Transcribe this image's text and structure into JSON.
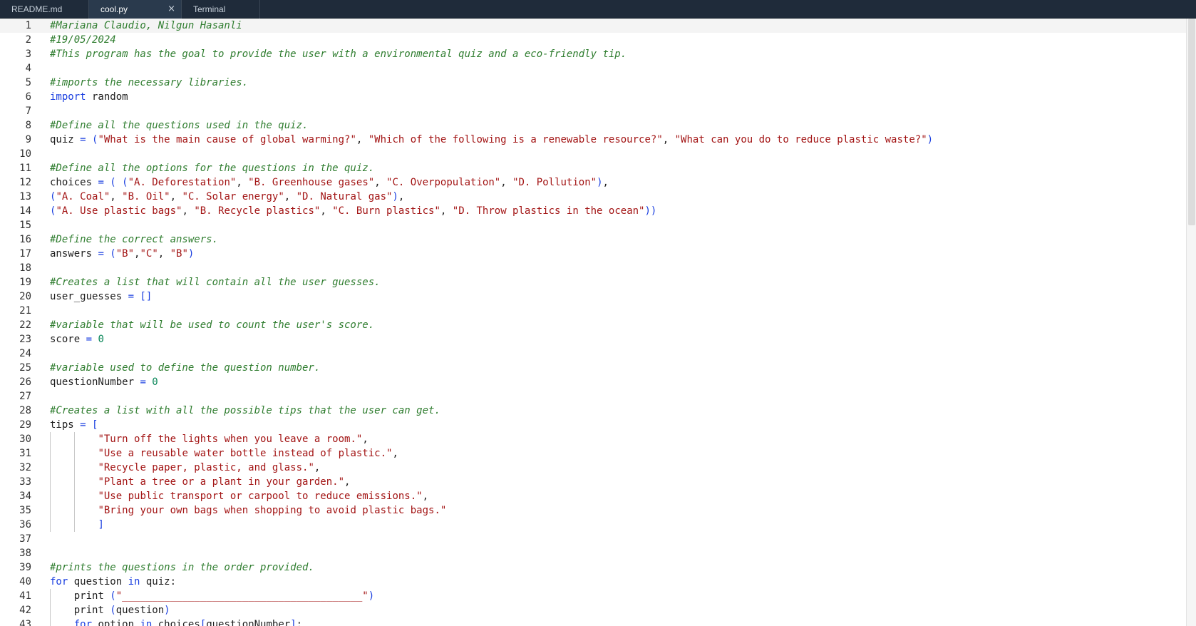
{
  "tabs": [
    {
      "label": "README.md",
      "active": false
    },
    {
      "label": "cool.py",
      "active": true,
      "close": "×"
    },
    {
      "label": "Terminal",
      "active": false
    }
  ],
  "editor": {
    "current_line": 1,
    "lines": [
      {
        "n": "1",
        "tokens": [
          {
            "c": "com",
            "t": "#Mariana Claudio, Nilgun Hasanli"
          }
        ]
      },
      {
        "n": "2",
        "tokens": [
          {
            "c": "com",
            "t": "#19/05/2024"
          }
        ]
      },
      {
        "n": "3",
        "tokens": [
          {
            "c": "com",
            "t": "#This program has the goal to provide the user with a environmental quiz and a eco-friendly tip."
          }
        ]
      },
      {
        "n": "4",
        "tokens": []
      },
      {
        "n": "5",
        "tokens": [
          {
            "c": "com",
            "t": "#imports the necessary libraries."
          }
        ]
      },
      {
        "n": "6",
        "tokens": [
          {
            "c": "kw",
            "t": "import"
          },
          {
            "c": "id",
            "t": " random"
          }
        ]
      },
      {
        "n": "7",
        "tokens": []
      },
      {
        "n": "8",
        "tokens": [
          {
            "c": "com",
            "t": "#Define all the questions used in the quiz."
          }
        ]
      },
      {
        "n": "9",
        "tokens": [
          {
            "c": "id",
            "t": "quiz "
          },
          {
            "c": "op",
            "t": "= ("
          },
          {
            "c": "str",
            "t": "\"What is the main cause of global warming?\""
          },
          {
            "c": "id",
            "t": ", "
          },
          {
            "c": "str",
            "t": "\"Which of the following is a renewable resource?\""
          },
          {
            "c": "id",
            "t": ", "
          },
          {
            "c": "str",
            "t": "\"What can you do to reduce plastic waste?\""
          },
          {
            "c": "op",
            "t": ")"
          }
        ]
      },
      {
        "n": "10",
        "tokens": []
      },
      {
        "n": "11",
        "tokens": [
          {
            "c": "com",
            "t": "#Define all the options for the questions in the quiz."
          }
        ]
      },
      {
        "n": "12",
        "tokens": [
          {
            "c": "id",
            "t": "choices "
          },
          {
            "c": "op",
            "t": "= ( ("
          },
          {
            "c": "str",
            "t": "\"A. Deforestation\""
          },
          {
            "c": "id",
            "t": ", "
          },
          {
            "c": "str",
            "t": "\"B. Greenhouse gases\""
          },
          {
            "c": "id",
            "t": ", "
          },
          {
            "c": "str",
            "t": "\"C. Overpopulation\""
          },
          {
            "c": "id",
            "t": ", "
          },
          {
            "c": "str",
            "t": "\"D. Pollution\""
          },
          {
            "c": "op",
            "t": ")"
          },
          {
            "c": "id",
            "t": ","
          }
        ]
      },
      {
        "n": "13",
        "tokens": [
          {
            "c": "op",
            "t": "("
          },
          {
            "c": "str",
            "t": "\"A. Coal\""
          },
          {
            "c": "id",
            "t": ", "
          },
          {
            "c": "str",
            "t": "\"B. Oil\""
          },
          {
            "c": "id",
            "t": ", "
          },
          {
            "c": "str",
            "t": "\"C. Solar energy\""
          },
          {
            "c": "id",
            "t": ", "
          },
          {
            "c": "str",
            "t": "\"D. Natural gas\""
          },
          {
            "c": "op",
            "t": ")"
          },
          {
            "c": "id",
            "t": ","
          }
        ]
      },
      {
        "n": "14",
        "tokens": [
          {
            "c": "op",
            "t": "("
          },
          {
            "c": "str",
            "t": "\"A. Use plastic bags\""
          },
          {
            "c": "id",
            "t": ", "
          },
          {
            "c": "str",
            "t": "\"B. Recycle plastics\""
          },
          {
            "c": "id",
            "t": ", "
          },
          {
            "c": "str",
            "t": "\"C. Burn plastics\""
          },
          {
            "c": "id",
            "t": ", "
          },
          {
            "c": "str",
            "t": "\"D. Throw plastics in the ocean\""
          },
          {
            "c": "op",
            "t": "))"
          }
        ]
      },
      {
        "n": "15",
        "tokens": []
      },
      {
        "n": "16",
        "tokens": [
          {
            "c": "com",
            "t": "#Define the correct answers."
          }
        ]
      },
      {
        "n": "17",
        "tokens": [
          {
            "c": "id",
            "t": "answers "
          },
          {
            "c": "op",
            "t": "= ("
          },
          {
            "c": "str",
            "t": "\"B\""
          },
          {
            "c": "id",
            "t": ","
          },
          {
            "c": "str",
            "t": "\"C\""
          },
          {
            "c": "id",
            "t": ", "
          },
          {
            "c": "str",
            "t": "\"B\""
          },
          {
            "c": "op",
            "t": ")"
          }
        ]
      },
      {
        "n": "18",
        "tokens": []
      },
      {
        "n": "19",
        "tokens": [
          {
            "c": "com",
            "t": "#Creates a list that will contain all the user guesses."
          }
        ]
      },
      {
        "n": "20",
        "tokens": [
          {
            "c": "id",
            "t": "user_guesses "
          },
          {
            "c": "op",
            "t": "= []"
          }
        ]
      },
      {
        "n": "21",
        "tokens": []
      },
      {
        "n": "22",
        "tokens": [
          {
            "c": "com",
            "t": "#variable that will be used to count the user's score."
          }
        ]
      },
      {
        "n": "23",
        "tokens": [
          {
            "c": "id",
            "t": "score "
          },
          {
            "c": "op",
            "t": "= "
          },
          {
            "c": "num",
            "t": "0"
          }
        ]
      },
      {
        "n": "24",
        "tokens": []
      },
      {
        "n": "25",
        "tokens": [
          {
            "c": "com",
            "t": "#variable used to define the question number."
          }
        ]
      },
      {
        "n": "26",
        "tokens": [
          {
            "c": "id",
            "t": "questionNumber "
          },
          {
            "c": "op",
            "t": "= "
          },
          {
            "c": "num",
            "t": "0"
          }
        ]
      },
      {
        "n": "27",
        "tokens": []
      },
      {
        "n": "28",
        "tokens": [
          {
            "c": "com",
            "t": "#Creates a list with all the possible tips that the user can get."
          }
        ]
      },
      {
        "n": "29",
        "tokens": [
          {
            "c": "id",
            "t": "tips "
          },
          {
            "c": "op",
            "t": "= ["
          }
        ]
      },
      {
        "n": "30",
        "guides": 2,
        "tokens": [
          {
            "c": "id",
            "t": "        "
          },
          {
            "c": "str",
            "t": "\"Turn off the lights when you leave a room.\""
          },
          {
            "c": "id",
            "t": ","
          }
        ]
      },
      {
        "n": "31",
        "guides": 2,
        "tokens": [
          {
            "c": "id",
            "t": "        "
          },
          {
            "c": "str",
            "t": "\"Use a reusable water bottle instead of plastic.\""
          },
          {
            "c": "id",
            "t": ","
          }
        ]
      },
      {
        "n": "32",
        "guides": 2,
        "tokens": [
          {
            "c": "id",
            "t": "        "
          },
          {
            "c": "str",
            "t": "\"Recycle paper, plastic, and glass.\""
          },
          {
            "c": "id",
            "t": ","
          }
        ]
      },
      {
        "n": "33",
        "guides": 2,
        "tokens": [
          {
            "c": "id",
            "t": "        "
          },
          {
            "c": "str",
            "t": "\"Plant a tree or a plant in your garden.\""
          },
          {
            "c": "id",
            "t": ","
          }
        ]
      },
      {
        "n": "34",
        "guides": 2,
        "tokens": [
          {
            "c": "id",
            "t": "        "
          },
          {
            "c": "str",
            "t": "\"Use public transport or carpool to reduce emissions.\""
          },
          {
            "c": "id",
            "t": ","
          }
        ]
      },
      {
        "n": "35",
        "guides": 2,
        "tokens": [
          {
            "c": "id",
            "t": "        "
          },
          {
            "c": "str",
            "t": "\"Bring your own bags when shopping to avoid plastic bags.\""
          }
        ]
      },
      {
        "n": "36",
        "guides": 2,
        "tokens": [
          {
            "c": "id",
            "t": "        "
          },
          {
            "c": "op",
            "t": "]"
          }
        ]
      },
      {
        "n": "37",
        "tokens": []
      },
      {
        "n": "38",
        "tokens": []
      },
      {
        "n": "39",
        "tokens": [
          {
            "c": "com",
            "t": "#prints the questions in the order provided."
          }
        ]
      },
      {
        "n": "40",
        "tokens": [
          {
            "c": "kw",
            "t": "for"
          },
          {
            "c": "id",
            "t": " question "
          },
          {
            "c": "kw",
            "t": "in"
          },
          {
            "c": "id",
            "t": " quiz:"
          }
        ]
      },
      {
        "n": "41",
        "guides": 1,
        "tokens": [
          {
            "c": "id",
            "t": "    print "
          },
          {
            "c": "op",
            "t": "("
          },
          {
            "c": "str",
            "t": "\"________________________________________\""
          },
          {
            "c": "op",
            "t": ")"
          }
        ]
      },
      {
        "n": "42",
        "guides": 1,
        "tokens": [
          {
            "c": "id",
            "t": "    print "
          },
          {
            "c": "op",
            "t": "("
          },
          {
            "c": "id",
            "t": "question"
          },
          {
            "c": "op",
            "t": ")"
          }
        ]
      },
      {
        "n": "43",
        "guides": 1,
        "tokens": [
          {
            "c": "id",
            "t": "    "
          },
          {
            "c": "kw",
            "t": "for"
          },
          {
            "c": "id",
            "t": " option "
          },
          {
            "c": "kw",
            "t": "in"
          },
          {
            "c": "id",
            "t": " choices"
          },
          {
            "c": "op",
            "t": "["
          },
          {
            "c": "id",
            "t": "questionNumber"
          },
          {
            "c": "op",
            "t": "]"
          },
          {
            "c": "id",
            "t": ":"
          }
        ]
      }
    ]
  },
  "colors": {
    "tabbar_bg": "#1f2b3a",
    "comment": "#2f7d2f",
    "keyword": "#1a3fe0",
    "string": "#a31515",
    "number": "#098658"
  },
  "scrollbar": {
    "visible_fraction": 0.34
  }
}
